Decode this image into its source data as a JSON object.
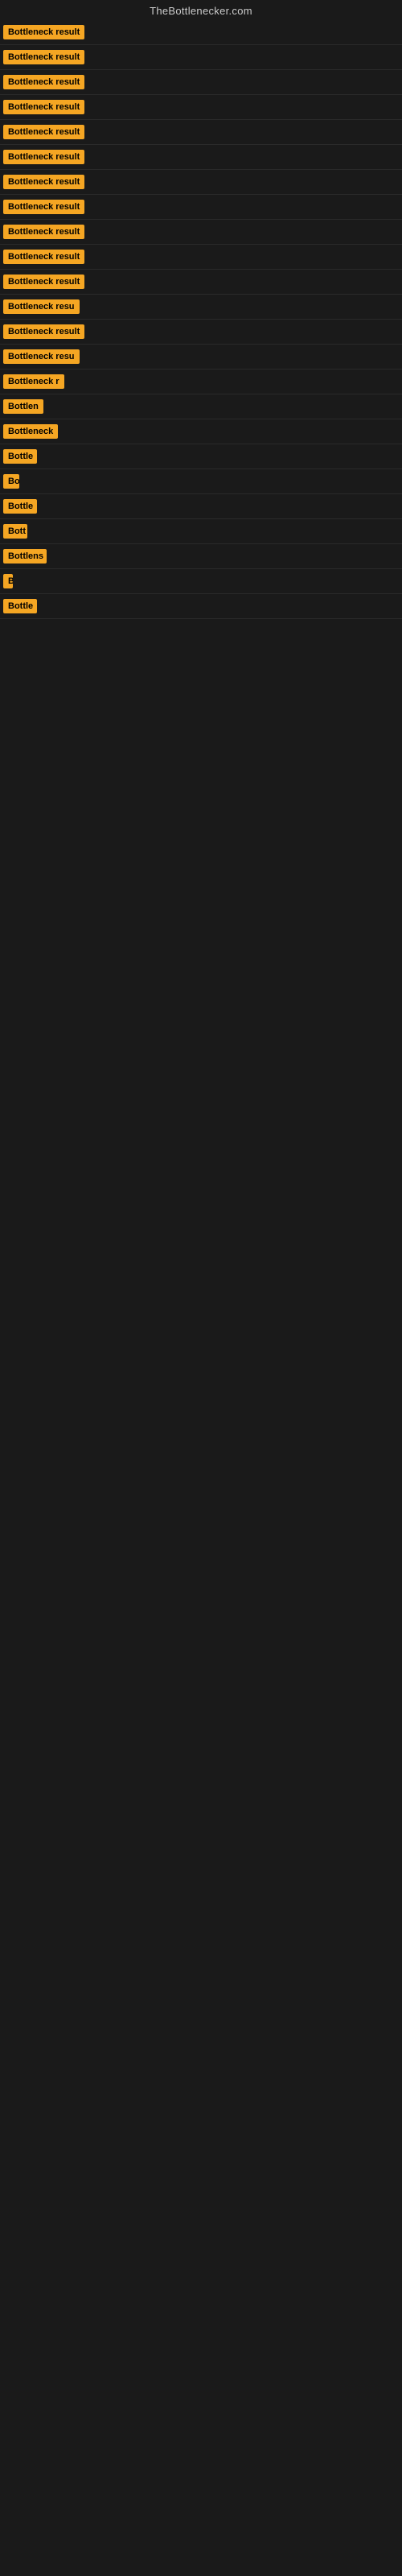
{
  "site": {
    "title": "TheBottlenecker.com"
  },
  "rows": [
    {
      "id": 1,
      "badge_text": "Bottleneck result",
      "truncated": false
    },
    {
      "id": 2,
      "badge_text": "Bottleneck result",
      "truncated": false
    },
    {
      "id": 3,
      "badge_text": "Bottleneck result",
      "truncated": false
    },
    {
      "id": 4,
      "badge_text": "Bottleneck result",
      "truncated": false
    },
    {
      "id": 5,
      "badge_text": "Bottleneck result",
      "truncated": false
    },
    {
      "id": 6,
      "badge_text": "Bottleneck result",
      "truncated": false
    },
    {
      "id": 7,
      "badge_text": "Bottleneck result",
      "truncated": false
    },
    {
      "id": 8,
      "badge_text": "Bottleneck result",
      "truncated": false
    },
    {
      "id": 9,
      "badge_text": "Bottleneck result",
      "truncated": false
    },
    {
      "id": 10,
      "badge_text": "Bottleneck result",
      "truncated": false
    },
    {
      "id": 11,
      "badge_text": "Bottleneck result",
      "truncated": false
    },
    {
      "id": 12,
      "badge_text": "Bottleneck resu",
      "truncated": true
    },
    {
      "id": 13,
      "badge_text": "Bottleneck result",
      "truncated": false
    },
    {
      "id": 14,
      "badge_text": "Bottleneck resu",
      "truncated": true
    },
    {
      "id": 15,
      "badge_text": "Bottleneck r",
      "truncated": true
    },
    {
      "id": 16,
      "badge_text": "Bottlen",
      "truncated": true
    },
    {
      "id": 17,
      "badge_text": "Bottleneck",
      "truncated": true
    },
    {
      "id": 18,
      "badge_text": "Bottle",
      "truncated": true
    },
    {
      "id": 19,
      "badge_text": "Bo",
      "truncated": true
    },
    {
      "id": 20,
      "badge_text": "Bottle",
      "truncated": true
    },
    {
      "id": 21,
      "badge_text": "Bott",
      "truncated": true
    },
    {
      "id": 22,
      "badge_text": "Bottlens",
      "truncated": true
    },
    {
      "id": 23,
      "badge_text": "B",
      "truncated": true
    },
    {
      "id": 24,
      "badge_text": "Bottle",
      "truncated": true
    }
  ]
}
